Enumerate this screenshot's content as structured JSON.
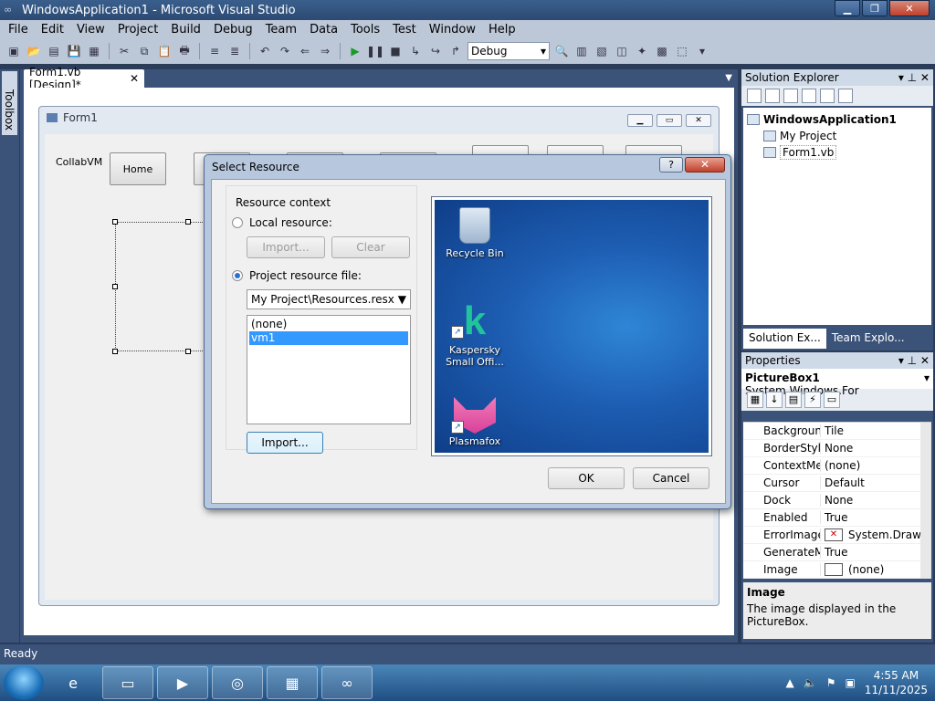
{
  "window": {
    "title": "WindowsApplication1 - Microsoft Visual Studio"
  },
  "menu": [
    "File",
    "Edit",
    "View",
    "Project",
    "Build",
    "Debug",
    "Team",
    "Data",
    "Tools",
    "Test",
    "Window",
    "Help"
  ],
  "toolbar": {
    "config": "Debug"
  },
  "toolbox": {
    "label": "Toolbox"
  },
  "doc_tab": {
    "label": "Form1.vb [Design]*",
    "close": "✕"
  },
  "form1": {
    "title": "Form1",
    "label": "CollabVM",
    "home_button": "Home"
  },
  "dialog": {
    "title": "Select Resource",
    "help": "?",
    "close": "✕",
    "resource_context": "Resource context",
    "local_resource": "Local resource:",
    "import_disabled": "Import...",
    "clear": "Clear",
    "project_resource_file": "Project resource file:",
    "resource_file": "My Project\\Resources.resx",
    "list": [
      "(none)",
      "vm1"
    ],
    "selected": "vm1",
    "import": "Import...",
    "ok": "OK",
    "cancel": "Cancel",
    "preview_icons": {
      "recycle_bin": "Recycle Bin",
      "kaspersky_line1": "Kaspersky",
      "kaspersky_line2": "Small Offi...",
      "plasmafox": "Plasmafox"
    }
  },
  "solution_explorer": {
    "title": "Solution Explorer",
    "project": "WindowsApplication1",
    "items": [
      "My Project",
      "Form1.vb"
    ],
    "tab_solution": "Solution Ex...",
    "tab_team": "Team Explo..."
  },
  "properties": {
    "title": "Properties",
    "object": "PictureBox1",
    "object_type": "System.Windows.For",
    "rows": [
      {
        "name": "Backgroun",
        "value": "Tile"
      },
      {
        "name": "BorderStyle",
        "value": "None"
      },
      {
        "name": "ContextMe",
        "value": "(none)"
      },
      {
        "name": "Cursor",
        "value": "Default"
      },
      {
        "name": "Dock",
        "value": "None"
      },
      {
        "name": "Enabled",
        "value": "True"
      },
      {
        "name": "ErrorImage",
        "value": "System.Drawi"
      },
      {
        "name": "GenerateM",
        "value": "True"
      },
      {
        "name": "Image",
        "value": "(none)"
      }
    ],
    "desc_title": "Image",
    "desc_text": "The image displayed in the PictureBox."
  },
  "status": {
    "text": "Ready"
  },
  "taskbar": {
    "time": "4:55 AM",
    "date": "11/11/2025"
  }
}
